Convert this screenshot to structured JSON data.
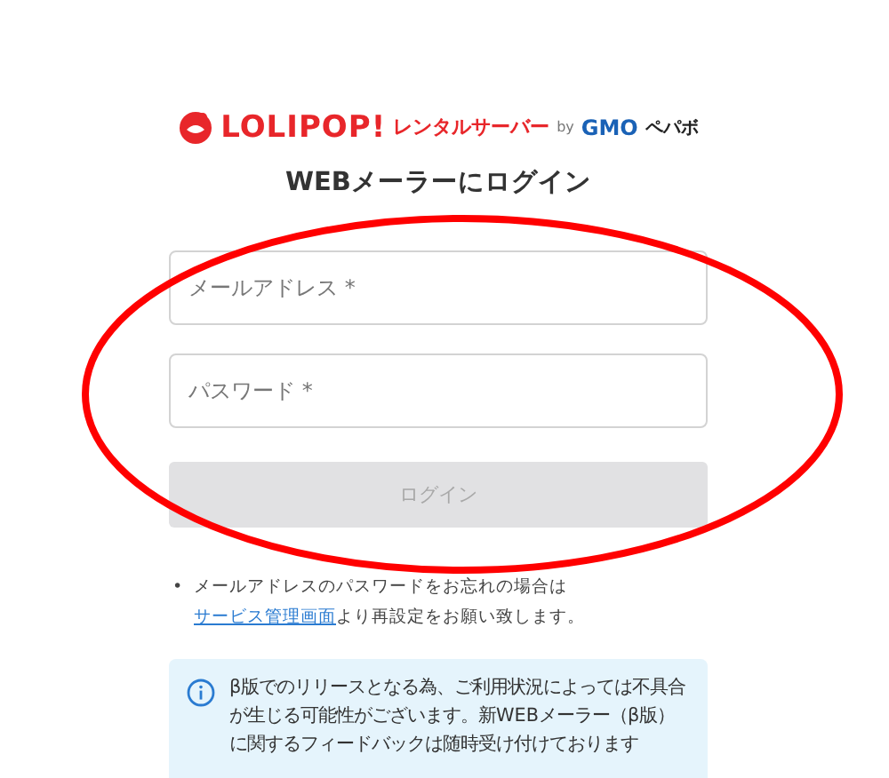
{
  "logo": {
    "brand": "LOLIPOP!",
    "service": "レンタルサーバー",
    "by": "by",
    "company": "GMO",
    "company_suffix": "ペパボ"
  },
  "title": "WEBメーラーにログイン",
  "fields": [
    {
      "placeholder": "メールアドレス *"
    },
    {
      "placeholder": "パスワード *"
    }
  ],
  "login_button": {
    "label": "ログイン",
    "disabled": true
  },
  "notes": [
    {
      "marker": "•",
      "before": "メールアドレスのパスワードをお忘れの場合は",
      "link": "サービス管理画面",
      "after": "より再設定をお願い致します。"
    }
  ],
  "info": {
    "text": "β版でのリリースとなる為、ご利用状況によっては不具合が生じる可能性がございます。新WEBメーラー（β版）に関するフィードバックは随時受け付けております"
  },
  "annotation": {
    "kind": "ellipse"
  }
}
